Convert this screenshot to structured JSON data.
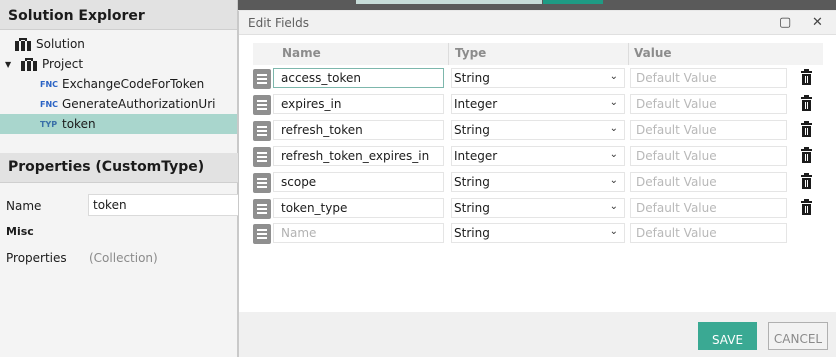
{
  "solution_explorer": {
    "title": "Solution Explorer",
    "tree": [
      {
        "label": "Solution",
        "icon": "briefcase-icon"
      },
      {
        "label": "Project",
        "icon": "briefcase-icon",
        "expanded": true
      },
      {
        "kind": "FNC",
        "label": "ExchangeCodeForToken"
      },
      {
        "kind": "FNC",
        "label": "GenerateAuthorizationUri"
      },
      {
        "kind": "TYP",
        "label": "token",
        "selected": true
      }
    ]
  },
  "properties": {
    "title": "Properties (CustomType)",
    "name_label": "Name",
    "name_value": "token",
    "section": "Misc",
    "properties_label": "Properties",
    "properties_value": "(Collection)"
  },
  "dialog": {
    "title": "Edit Fields",
    "maximize_icon": "maximize-icon",
    "close_icon": "close-icon",
    "columns": [
      "Name",
      "Type",
      "Value"
    ],
    "value_placeholder": "Default Value",
    "name_placeholder": "Name",
    "fields": [
      {
        "name": "access_token",
        "type": "String"
      },
      {
        "name": "expires_in",
        "type": "Integer"
      },
      {
        "name": "refresh_token",
        "type": "String"
      },
      {
        "name": "refresh_token_expires_in",
        "type": "Integer"
      },
      {
        "name": "scope",
        "type": "String"
      },
      {
        "name": "token_type",
        "type": "String"
      }
    ],
    "new_field_type": "String",
    "save_label": "SAVE",
    "cancel_label": "CANCEL"
  },
  "colors": {
    "accent": "#3aa993",
    "selection": "#a9d6cd"
  }
}
